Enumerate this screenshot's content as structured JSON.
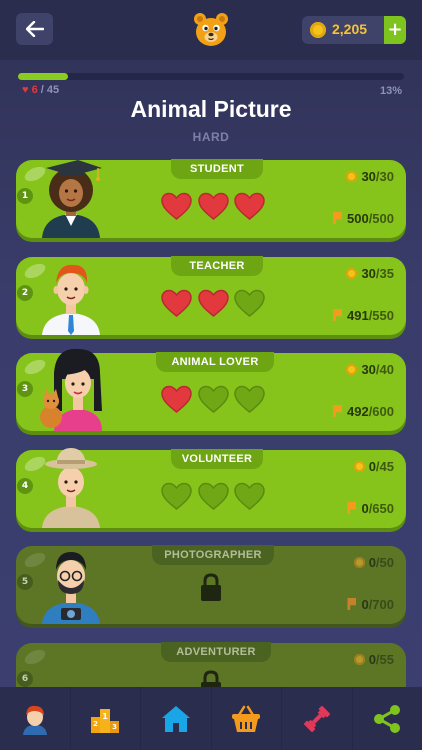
{
  "header": {
    "back_icon": "arrow-left-icon",
    "logo_icon": "bear-face-icon",
    "coins": "2,205",
    "add_label": "+"
  },
  "progress": {
    "fraction": 0.13,
    "hearts_current": "6",
    "hearts_total": "/ 45",
    "percent_label": "13%"
  },
  "title": "Animal Picture",
  "difficulty": "HARD",
  "levels": [
    {
      "number": "1",
      "name": "STUDENT",
      "coins": "30",
      "coins_max": "/30",
      "tickets": "500",
      "tickets_max": "/500",
      "hearts_filled": 3,
      "locked": false
    },
    {
      "number": "2",
      "name": "TEACHER",
      "coins": "30",
      "coins_max": "/35",
      "tickets": "491",
      "tickets_max": "/550",
      "hearts_filled": 2,
      "locked": false
    },
    {
      "number": "3",
      "name": "ANIMAL LOVER",
      "coins": "30",
      "coins_max": "/40",
      "tickets": "492",
      "tickets_max": "/600",
      "hearts_filled": 1,
      "locked": false
    },
    {
      "number": "4",
      "name": "VOLUNTEER",
      "coins": "0",
      "coins_max": "/45",
      "tickets": "0",
      "tickets_max": "/650",
      "hearts_filled": 0,
      "locked": false
    },
    {
      "number": "5",
      "name": "PHOTOGRAPHER",
      "coins": "0",
      "coins_max": "/50",
      "tickets": "0",
      "tickets_max": "/700",
      "locked": true
    },
    {
      "number": "6",
      "name": "ADVENTURER",
      "coins": "0",
      "coins_max": "/55",
      "locked": true
    }
  ],
  "nav": [
    {
      "name": "profile",
      "icon": "avatar-icon"
    },
    {
      "name": "leaderboard",
      "icon": "podium-icon"
    },
    {
      "name": "home",
      "icon": "home-icon"
    },
    {
      "name": "shop",
      "icon": "basket-icon"
    },
    {
      "name": "training",
      "icon": "dumbbell-icon"
    },
    {
      "name": "share",
      "icon": "share-icon"
    }
  ],
  "colors": {
    "accent": "#86c41b",
    "heart": "#e2393e",
    "coin": "#f6c437",
    "background": "#3a3d6b"
  }
}
